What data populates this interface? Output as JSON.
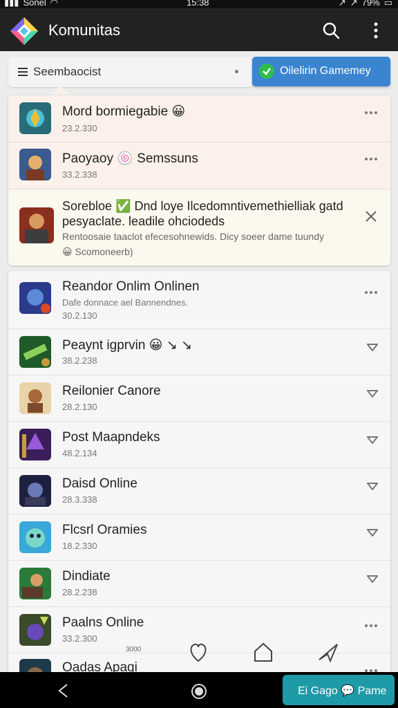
{
  "status_bar": {
    "carrier": "Sonel",
    "time": "15:38",
    "battery": "79%"
  },
  "app_bar": {
    "title": "Komunitas"
  },
  "filter": {
    "label": "Seembaocist"
  },
  "primary_button": {
    "label": "Oilelirin Gamemey"
  },
  "top_rows": [
    {
      "name": "Mord bormiegabie 😀",
      "date": "23.2.330"
    },
    {
      "name": "Paoyaoy 🍥 Semssuns",
      "date": "33.2.338"
    }
  ],
  "expanded_item": {
    "line1": "Sorebloe ✅ Dnd loye Ilcedomntivemethielliak gatd",
    "line2": "pesyaclate. leadile ohciodeds",
    "line3": "Rentoosaie taaclot efecesohnewids. Dicy soeer dame tuundy",
    "line4": "😀 Scomoneerb)"
  },
  "list_rows": [
    {
      "name": "Reandor Onlim Onlinen",
      "subtitle": "Dafe donnace ael Bannendnes.",
      "date": "30.2.130",
      "action": "more"
    },
    {
      "name": "Peaynt igprvin 😀 ↘ ↘",
      "date": "38.2.238",
      "action": "caret"
    },
    {
      "name": "Reilonier Canore",
      "date": "28.2.130",
      "action": "caret"
    },
    {
      "name": "Post Maapndeks",
      "date": "48.2.134",
      "action": "caret"
    },
    {
      "name": "Daisd Online",
      "date": "28.3.338",
      "action": "caret"
    },
    {
      "name": "Flcsrl Oramies",
      "date": "18.2.330",
      "action": "caret"
    },
    {
      "name": "Dindiate",
      "date": "28.2.238",
      "action": "caret"
    },
    {
      "name": "Paalns Online",
      "date": "33.2.300",
      "action": "more"
    },
    {
      "name": "Oadas Apagi",
      "date": "",
      "action": "more"
    }
  ],
  "bottom_tabs": {
    "tab1_label": "3000"
  },
  "cta_button": {
    "label": "Ei Gago 💬 Pame"
  },
  "colors": {
    "accent": "#3a84d0",
    "cta": "#1f9aa7",
    "appbar": "#222222"
  }
}
